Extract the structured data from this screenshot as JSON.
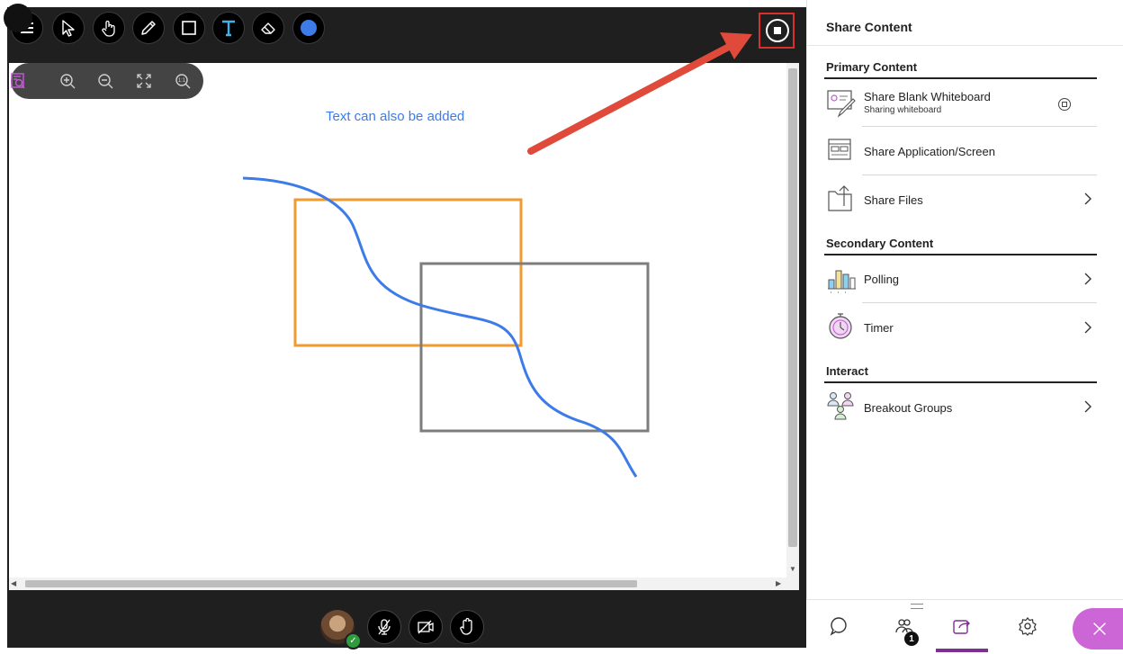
{
  "toolbar": {
    "tools": [
      "menu-icon",
      "select-icon",
      "pan-icon",
      "pencil-icon",
      "rectangle-icon",
      "text-icon",
      "eraser-icon",
      "color-icon"
    ],
    "accent": "#3d7be8",
    "stop_tooltip": "Stop Sharing"
  },
  "canvas_toolbar": {
    "buttons": [
      "zoom-region-icon",
      "zoom-in-icon",
      "zoom-out-icon",
      "fit-screen-icon",
      "actual-size-icon"
    ]
  },
  "whiteboard": {
    "text": "Text can also be added",
    "colors": {
      "text": "#3d7be8",
      "curve": "#3d7be8",
      "rect1": "#f29a2e",
      "rect2": "#7d7d7d"
    }
  },
  "bottom_bar": {
    "buttons": [
      "mute-microphone-icon",
      "camera-off-icon",
      "raise-hand-icon"
    ],
    "status_color": "#2e9b3f"
  },
  "panel": {
    "title": "Share Content",
    "sections": {
      "primary": {
        "title": "Primary Content",
        "items": [
          {
            "label": "Share Blank Whiteboard",
            "sub": "Sharing whiteboard"
          },
          {
            "label": "Share Application/Screen"
          },
          {
            "label": "Share Files"
          }
        ]
      },
      "secondary": {
        "title": "Secondary Content",
        "items": [
          {
            "label": "Polling"
          },
          {
            "label": "Timer"
          }
        ]
      },
      "interact": {
        "title": "Interact",
        "items": [
          {
            "label": "Breakout Groups"
          }
        ]
      }
    },
    "tabs": {
      "items": [
        "chat-icon",
        "attendees-icon",
        "share-content-icon",
        "settings-icon",
        "close-icon"
      ],
      "attendees_badge": "1",
      "active": "share-content-icon",
      "accent": "#7e2f92",
      "close_color": "#cc66d6"
    }
  }
}
